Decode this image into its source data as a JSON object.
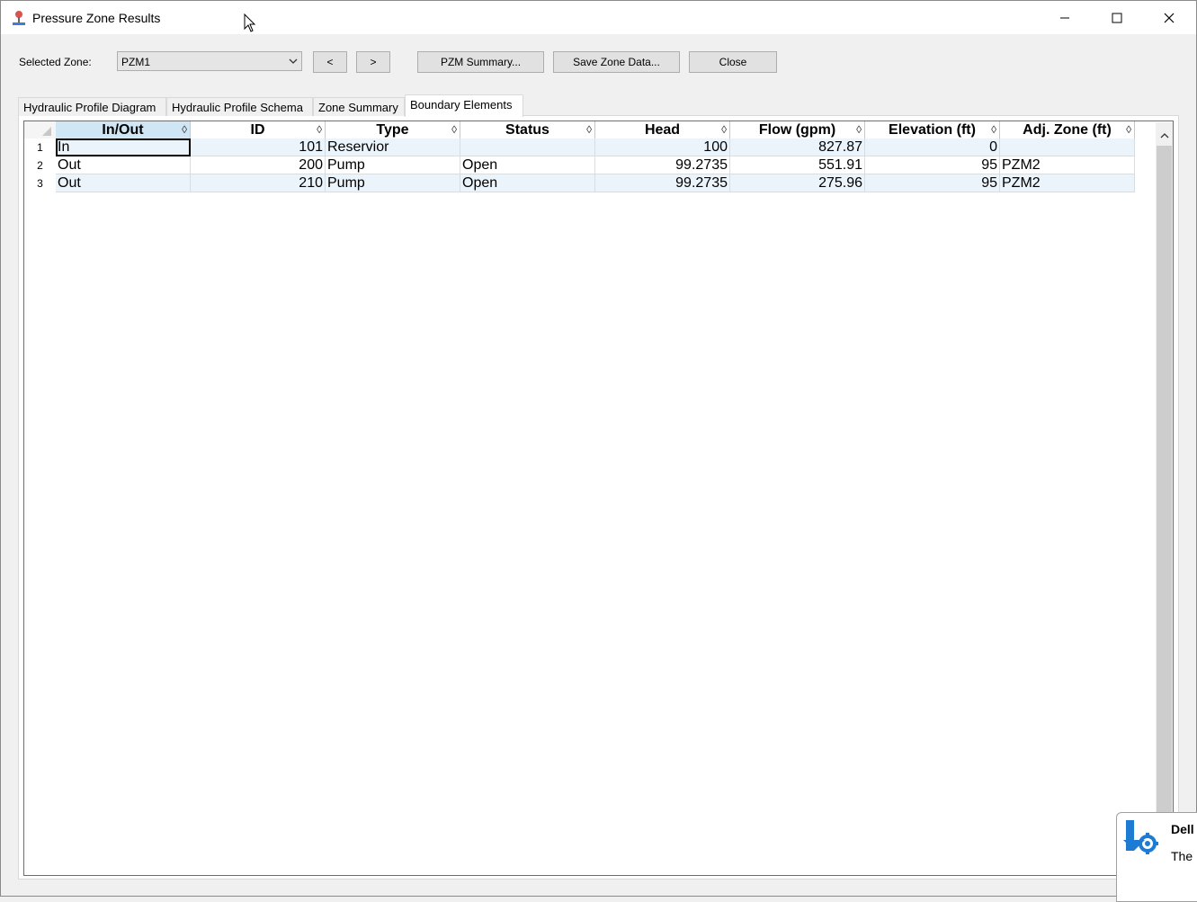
{
  "window": {
    "title": "Pressure Zone Results"
  },
  "toolbar": {
    "zone_label": "Selected Zone:",
    "zone_value": "PZM1",
    "prev_label": "<",
    "next_label": ">",
    "summary_label": "PZM Summary...",
    "save_label": "Save Zone Data...",
    "close_label": "Close"
  },
  "tabs": [
    {
      "label": "Hydraulic Profile Diagram"
    },
    {
      "label": "Hydraulic Profile Schema"
    },
    {
      "label": "Zone Summary"
    },
    {
      "label": "Boundary Elements",
      "active": true
    }
  ],
  "grid": {
    "columns": [
      "In/Out",
      "ID",
      "Type",
      "Status",
      "Head",
      "Flow (gpm)",
      "Elevation (ft)",
      "Adj. Zone (ft)"
    ],
    "sort_glyph": "◊",
    "rows": [
      {
        "num": "1",
        "cells": [
          "In",
          "101",
          "Reservior",
          "",
          "100",
          "827.87",
          "0",
          ""
        ]
      },
      {
        "num": "2",
        "cells": [
          "Out",
          "200",
          "Pump",
          "Open",
          "99.2735",
          "551.91",
          "95",
          "PZM2"
        ]
      },
      {
        "num": "3",
        "cells": [
          "Out",
          "210",
          "Pump",
          "Open",
          "99.2735",
          "275.96",
          "95",
          "PZM2"
        ]
      }
    ]
  },
  "toast": {
    "title": "Dell",
    "text": "The"
  }
}
